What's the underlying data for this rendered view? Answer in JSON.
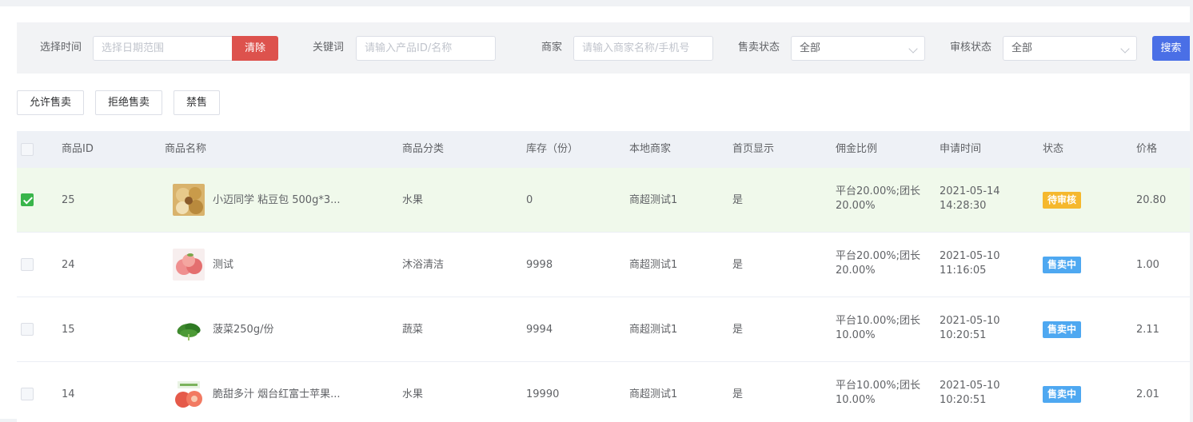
{
  "filters": {
    "time_label": "选择时间",
    "date_placeholder": "选择日期范围",
    "clear_label": "清除",
    "keyword_label": "关键词",
    "keyword_placeholder": "请输入产品ID/名称",
    "merchant_label": "商家",
    "merchant_placeholder": "请输入商家名称/手机号",
    "sale_status_label": "售卖状态",
    "sale_status_value": "全部",
    "audit_status_label": "审核状态",
    "audit_status_value": "全部",
    "search_label": "搜索"
  },
  "actions": {
    "allow": "允许售卖",
    "reject": "拒绝售卖",
    "ban": "禁售"
  },
  "table": {
    "columns": [
      "商品ID",
      "商品名称",
      "商品分类",
      "库存（份）",
      "本地商家",
      "首页显示",
      "佣金比例",
      "申请时间",
      "状态",
      "价格"
    ],
    "rows": [
      {
        "id": "25",
        "name": "小迈同学 粘豆包 500g*3...",
        "thumb": "bread-icon",
        "category": "水果",
        "stock": "0",
        "merchant": "商超测试1",
        "home": "是",
        "commission_1": "平台20.00%;团长",
        "commission_2": "20.00%",
        "date": "2021-05-14",
        "time": "14:28:30",
        "status": "待审核",
        "status_color": "#f5b82e",
        "price": "20.80",
        "checked": true
      },
      {
        "id": "24",
        "name": "测试",
        "thumb": "peach-icon",
        "category": "沐浴清洁",
        "stock": "9998",
        "merchant": "商超测试1",
        "home": "是",
        "commission_1": "平台20.00%;团长",
        "commission_2": "20.00%",
        "date": "2021-05-10",
        "time": "11:16:05",
        "status": "售卖中",
        "status_color": "#4ea8f1",
        "price": "1.00",
        "checked": false
      },
      {
        "id": "15",
        "name": "菠菜250g/份",
        "thumb": "spinach-icon",
        "category": "蔬菜",
        "stock": "9994",
        "merchant": "商超测试1",
        "home": "是",
        "commission_1": "平台10.00%;团长",
        "commission_2": "10.00%",
        "date": "2021-05-10",
        "time": "10:20:51",
        "status": "售卖中",
        "status_color": "#4ea8f1",
        "price": "2.11",
        "checked": false
      },
      {
        "id": "14",
        "name": "脆甜多汁 烟台红富士苹果...",
        "thumb": "apple-box-icon",
        "category": "水果",
        "stock": "19990",
        "merchant": "商超测试1",
        "home": "是",
        "commission_1": "平台10.00%;团长",
        "commission_2": "10.00%",
        "date": "2021-05-10",
        "time": "10:20:51",
        "status": "售卖中",
        "status_color": "#4ea8f1",
        "price": "2.01",
        "checked": false
      }
    ]
  }
}
